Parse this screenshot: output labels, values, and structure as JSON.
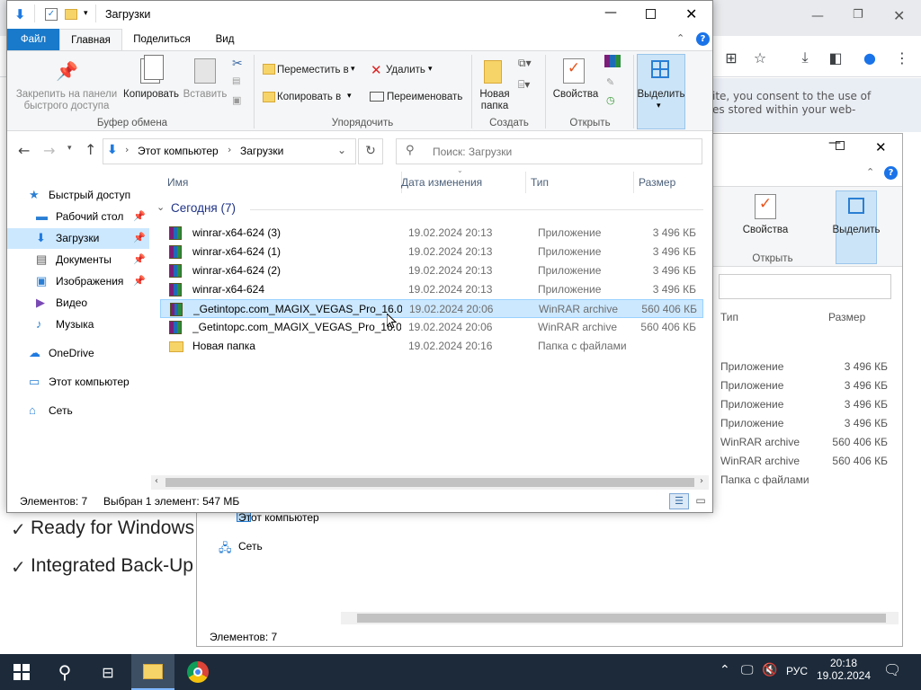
{
  "browser": {
    "consent_line1": "ite, you consent to the use of",
    "consent_line2": "es stored within your web-",
    "check_line1": "Ready for Windows",
    "check_line2": "Integrated Back-Up"
  },
  "window2": {
    "ribbon": {
      "properties": "Свойства",
      "select": "Выделить",
      "open_group": "Открыть"
    },
    "columns": {
      "type": "Тип",
      "size": "Размер"
    },
    "rows": [
      {
        "type": "Приложение",
        "size": "3 496 КБ"
      },
      {
        "type": "Приложение",
        "size": "3 496 КБ"
      },
      {
        "type": "Приложение",
        "size": "3 496 КБ"
      },
      {
        "type": "Приложение",
        "size": "3 496 КБ"
      },
      {
        "type": "WinRAR archive",
        "size": "560 406 КБ"
      },
      {
        "type": "WinRAR archive",
        "size": "560 406 КБ"
      },
      {
        "type": "Папка с файлами",
        "size": ""
      }
    ],
    "nav": {
      "this_pc": "Этот компьютер",
      "network": "Сеть"
    },
    "status": "Элементов: 7"
  },
  "window": {
    "title": "Загрузки",
    "tabs": {
      "file": "Файл",
      "home": "Главная",
      "share": "Поделиться",
      "view": "Вид"
    },
    "ribbon": {
      "pin": "Закрепить на панели быстрого доступа",
      "copy": "Копировать",
      "paste": "Вставить",
      "clipboard_group": "Буфер обмена",
      "move_to": "Переместить в",
      "copy_to": "Копировать в",
      "delete": "Удалить",
      "rename": "Переименовать",
      "organize_group": "Упорядочить",
      "new_folder": "Новая папка",
      "create_group": "Создать",
      "properties": "Свойства",
      "open_group": "Открыть",
      "select": "Выделить"
    },
    "address": {
      "this_pc": "Этот компьютер",
      "current": "Загрузки",
      "search_placeholder": "Поиск: Загрузки"
    },
    "nav": [
      {
        "label": "Быстрый доступ",
        "icon": "star-icon"
      },
      {
        "label": "Рабочий стол",
        "icon": "desktop-icon",
        "pinned": true
      },
      {
        "label": "Загрузки",
        "icon": "downloads-icon",
        "pinned": true,
        "selected": true
      },
      {
        "label": "Документы",
        "icon": "documents-icon",
        "pinned": true
      },
      {
        "label": "Изображения",
        "icon": "pictures-icon",
        "pinned": true
      },
      {
        "label": "Видео",
        "icon": "video-icon"
      },
      {
        "label": "Музыка",
        "icon": "music-icon"
      },
      {
        "label": "OneDrive",
        "icon": "onedrive-icon"
      },
      {
        "label": "Этот компьютер",
        "icon": "computer-icon"
      },
      {
        "label": "Сеть",
        "icon": "network-icon"
      }
    ],
    "columns": {
      "name": "Имя",
      "date": "Дата изменения",
      "type": "Тип",
      "size": "Размер"
    },
    "group_header": "Сегодня (7)",
    "files": [
      {
        "name": "winrar-x64-624 (3)",
        "date": "19.02.2024 20:13",
        "type": "Приложение",
        "size": "3 496 КБ",
        "icon": "winrar-icon"
      },
      {
        "name": "winrar-x64-624 (1)",
        "date": "19.02.2024 20:13",
        "type": "Приложение",
        "size": "3 496 КБ",
        "icon": "winrar-icon"
      },
      {
        "name": "winrar-x64-624 (2)",
        "date": "19.02.2024 20:13",
        "type": "Приложение",
        "size": "3 496 КБ",
        "icon": "winrar-icon"
      },
      {
        "name": "winrar-x64-624",
        "date": "19.02.2024 20:13",
        "type": "Приложение",
        "size": "3 496 КБ",
        "icon": "winrar-icon"
      },
      {
        "name": "_Getintopc.com_MAGIX_VEGAS_Pro_16.0...",
        "date": "19.02.2024 20:06",
        "type": "WinRAR archive",
        "size": "560 406 КБ",
        "icon": "archive-icon",
        "selected": true
      },
      {
        "name": "_Getintopc.com_MAGIX_VEGAS_Pro_16.0...",
        "date": "19.02.2024 20:06",
        "type": "WinRAR archive",
        "size": "560 406 КБ",
        "icon": "archive-icon"
      },
      {
        "name": "Новая папка",
        "date": "19.02.2024 20:16",
        "type": "Папка с файлами",
        "size": "",
        "icon": "folder-icon"
      }
    ],
    "status": {
      "count": "Элементов: 7",
      "selected": "Выбран 1 элемент: 547 МБ"
    }
  },
  "taskbar": {
    "lang": "РУС",
    "time": "20:18",
    "date": "19.02.2024"
  },
  "colors": {
    "accent": "#0063b1",
    "selection": "#cce8ff",
    "taskbar": "#1c2a3a"
  }
}
